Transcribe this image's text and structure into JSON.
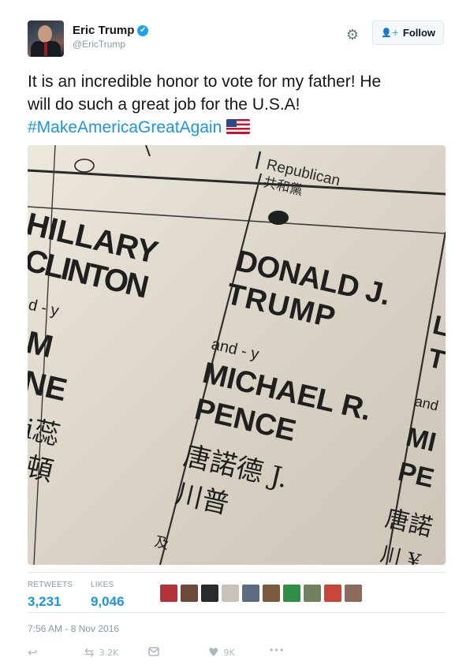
{
  "user": {
    "display_name": "Eric Trump",
    "handle": "@EricTrump",
    "verified_glyph": "✔"
  },
  "header": {
    "follow_label": "Follow",
    "follow_icon": "👤+",
    "gear_icon": "⚙"
  },
  "tweet": {
    "text_line1": "It is an incredible honor to vote for my father! He",
    "text_line2": "will do such a great job for the U.S.A!",
    "hashtag": "#MakeAmericaGreatAgain",
    "flag_icon": "us-flag"
  },
  "ballot": {
    "party_en": "Republican",
    "party_zh": "共和黨",
    "left_name1": "HILLARY",
    "left_name2": "CLINTON",
    "left_and": "d - y",
    "left_m": "M",
    "left_ne": "NE",
    "left_zh1": "i蕊",
    "left_zh2": "頓",
    "mid_name1": "DONALD J.",
    "mid_name2": "TRUMP",
    "mid_and": "and - y",
    "mid_vp1": "MICHAEL R.",
    "mid_vp2": "PENCE",
    "mid_zh1": "唐諾德 J.",
    "mid_zh2": "川普",
    "mid_zh3": "及",
    "right_l": "L",
    "right_t": "T",
    "right_and": "and",
    "right_mi": "MI",
    "right_pe": "PE",
    "right_zh": "唐諾",
    "right_zh2": "川 ¥"
  },
  "stats": {
    "retweets_label": "RETWEETS",
    "retweets_value": "3,231",
    "likes_label": "LIKES",
    "likes_value": "9,046"
  },
  "liker_colors": [
    "#b5323a",
    "#6b4a3a",
    "#2a2a2a",
    "#c9c2b6",
    "#5d6b82",
    "#7a5a3c",
    "#2f8f46",
    "#708060",
    "#c8453a",
    "#8a6a5a"
  ],
  "timestamp": "7:56 AM - 8 Nov 2016",
  "actions": {
    "reply_icon": "↩",
    "retweet_icon": "⇆",
    "retweet_count": "3.2K",
    "like_icon": "♥",
    "like_count": "9K",
    "more_icon": "•••"
  }
}
